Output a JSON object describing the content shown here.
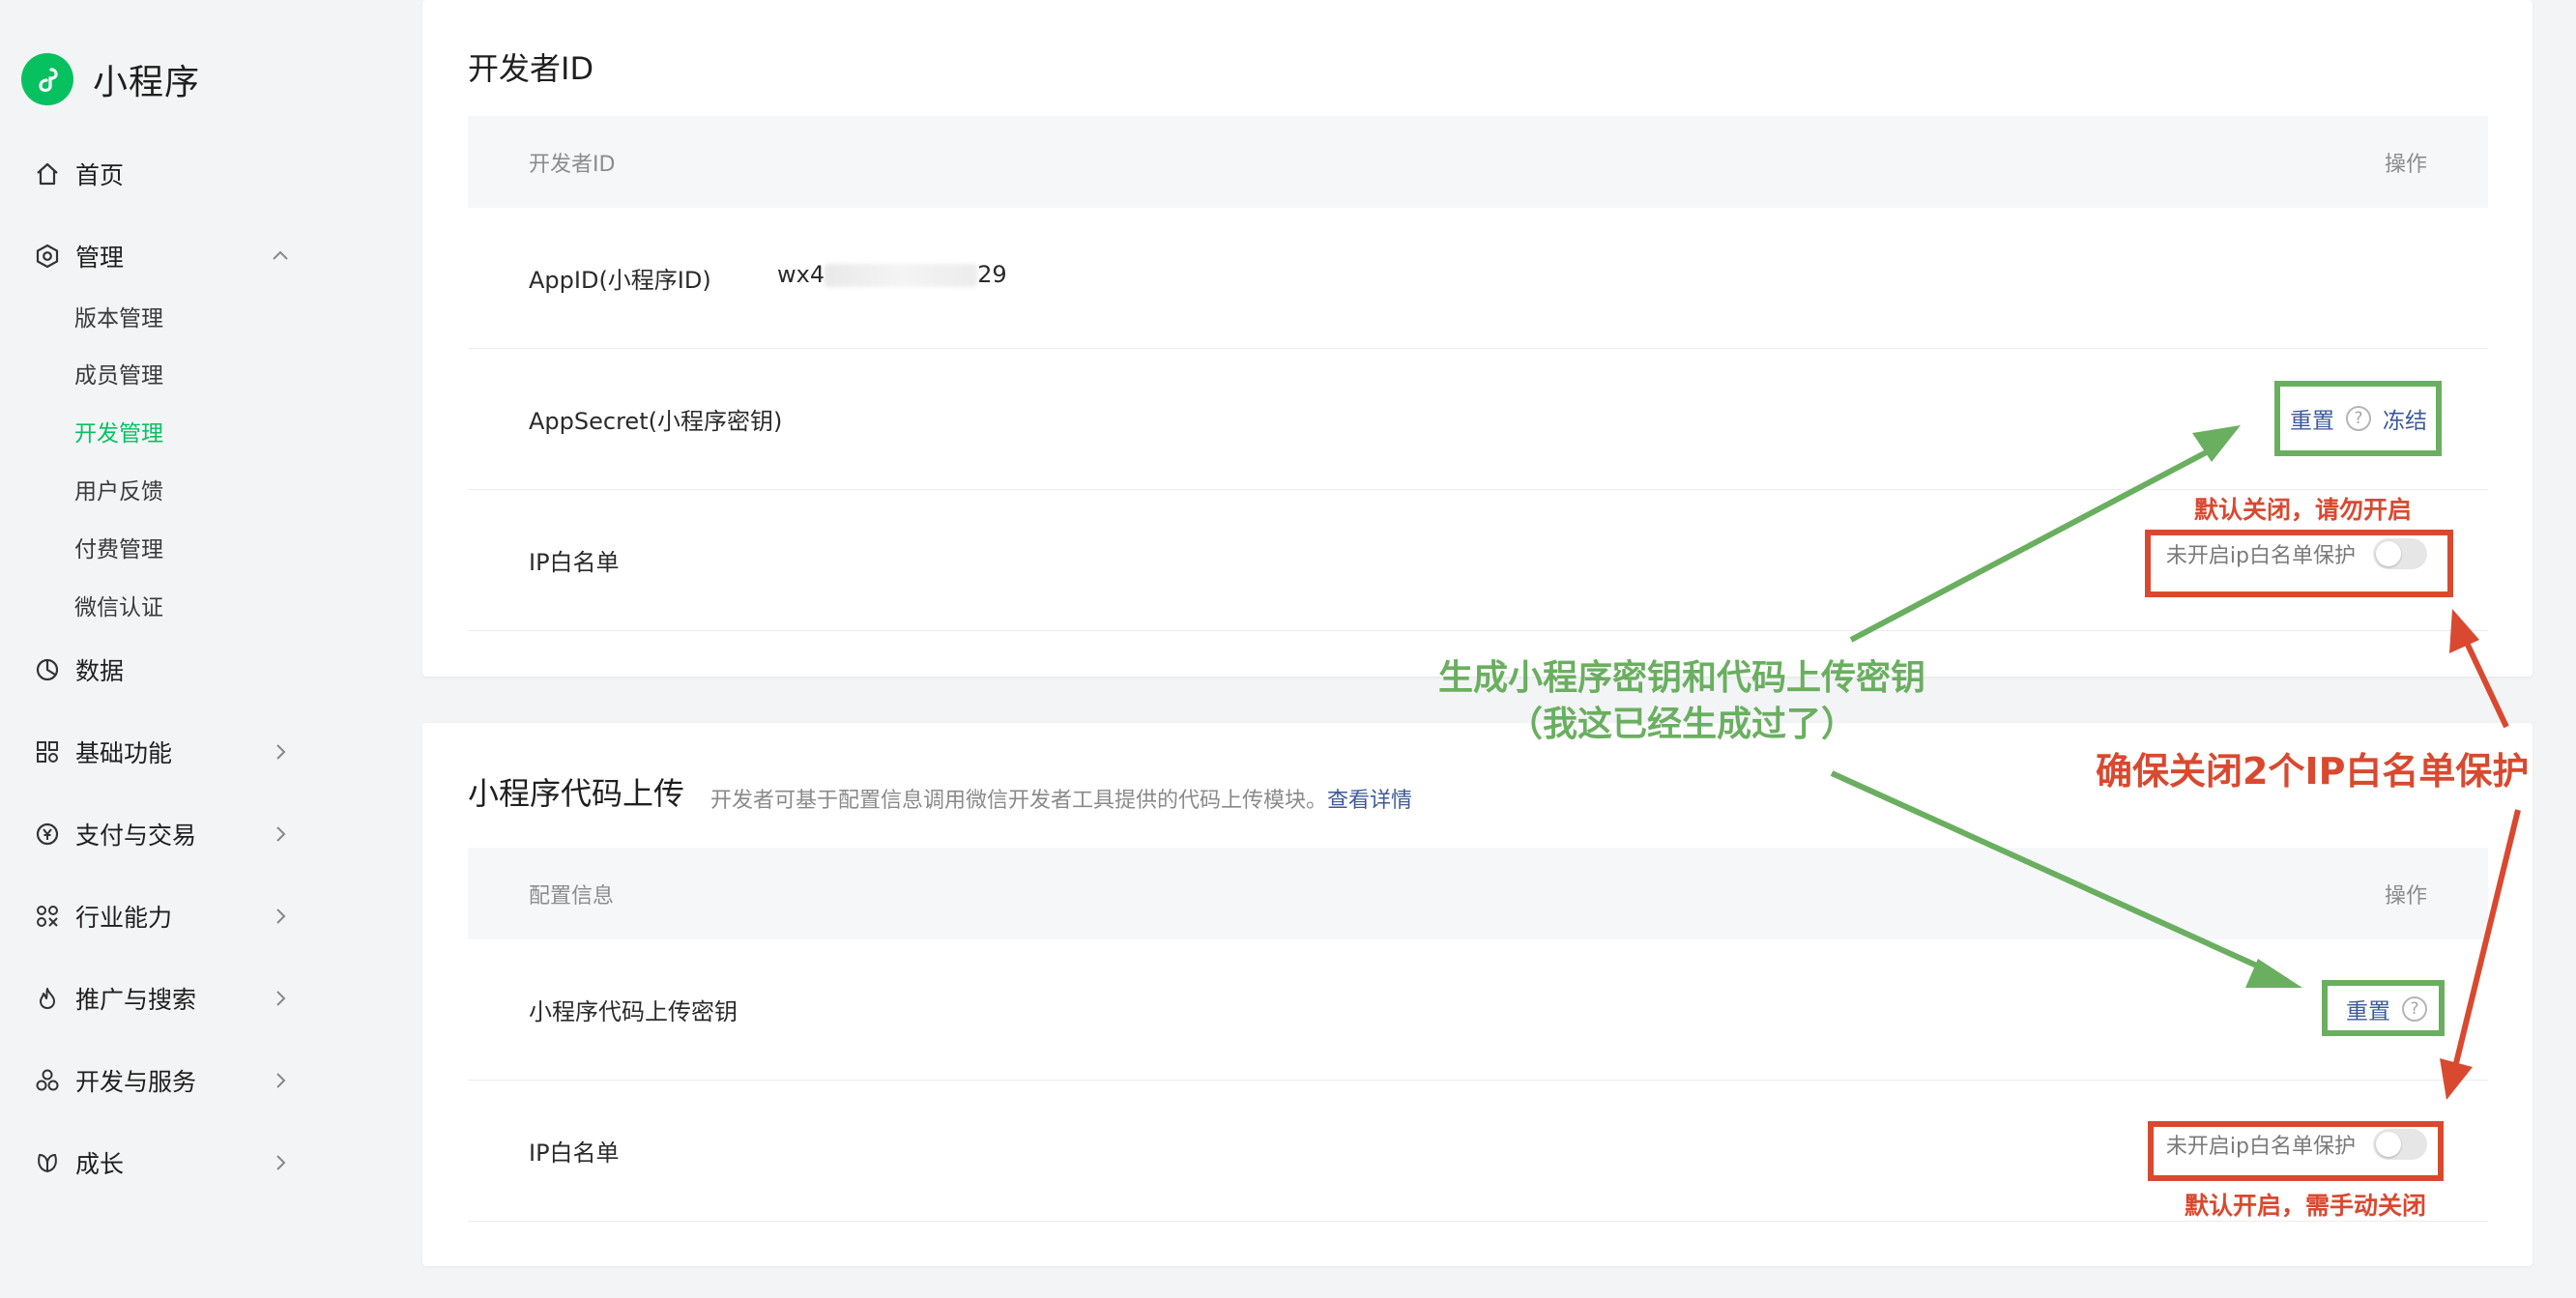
{
  "app": {
    "title": "小程序"
  },
  "sidebar": {
    "items": [
      {
        "label": "首页",
        "icon": "home-icon"
      },
      {
        "label": "管理",
        "icon": "settings-hexagon-icon",
        "expanded": true,
        "children": [
          "版本管理",
          "成员管理",
          "开发管理",
          "用户反馈",
          "付费管理",
          "微信认证"
        ],
        "active_child": "开发管理"
      },
      {
        "label": "数据",
        "icon": "pie-chart-icon"
      },
      {
        "label": "基础功能",
        "icon": "grid-icon"
      },
      {
        "label": "支付与交易",
        "icon": "yen-icon"
      },
      {
        "label": "行业能力",
        "icon": "industry-icon"
      },
      {
        "label": "推广与搜索",
        "icon": "flame-icon"
      },
      {
        "label": "开发与服务",
        "icon": "cluster-icon"
      },
      {
        "label": "成长",
        "icon": "leaf-icon"
      }
    ]
  },
  "dev_id_section": {
    "title": "开发者ID",
    "header": {
      "left": "开发者ID",
      "right": "操作"
    },
    "rows": {
      "appid": {
        "label": "AppID(小程序ID)",
        "value_prefix": "wx4",
        "value_suffix": "29"
      },
      "appsecret": {
        "label": "AppSecret(小程序密钥)",
        "reset": "重置",
        "help": "?",
        "freeze": "冻结"
      },
      "ip": {
        "label": "IP白名单",
        "toggle_label": "未开启ip白名单保护",
        "toggle_on": false
      }
    }
  },
  "upload_section": {
    "title": "小程序代码上传",
    "desc": "开发者可基于配置信息调用微信开发者工具提供的代码上传模块。",
    "desc_link": "查看详情",
    "header": {
      "left": "配置信息",
      "right": "操作"
    },
    "rows": {
      "key": {
        "label": "小程序代码上传密钥",
        "reset": "重置",
        "help": "?"
      },
      "ip": {
        "label": "IP白名单",
        "toggle_label": "未开启ip白名单保护",
        "toggle_on": false
      }
    }
  },
  "annotations": {
    "red_top": "默认关闭，请勿开启",
    "red_bottom": "默认开启，需手动关闭",
    "red_main": "确保关闭2个IP白名单保护",
    "green_line1": "生成小程序密钥和代码上传密钥",
    "green_line2": "（我这已经生成过了）",
    "colors": {
      "green": "#6aaf60",
      "red": "#d9492f"
    }
  },
  "colors": {
    "brand": "#07c160",
    "link": "#3d5a9a"
  }
}
